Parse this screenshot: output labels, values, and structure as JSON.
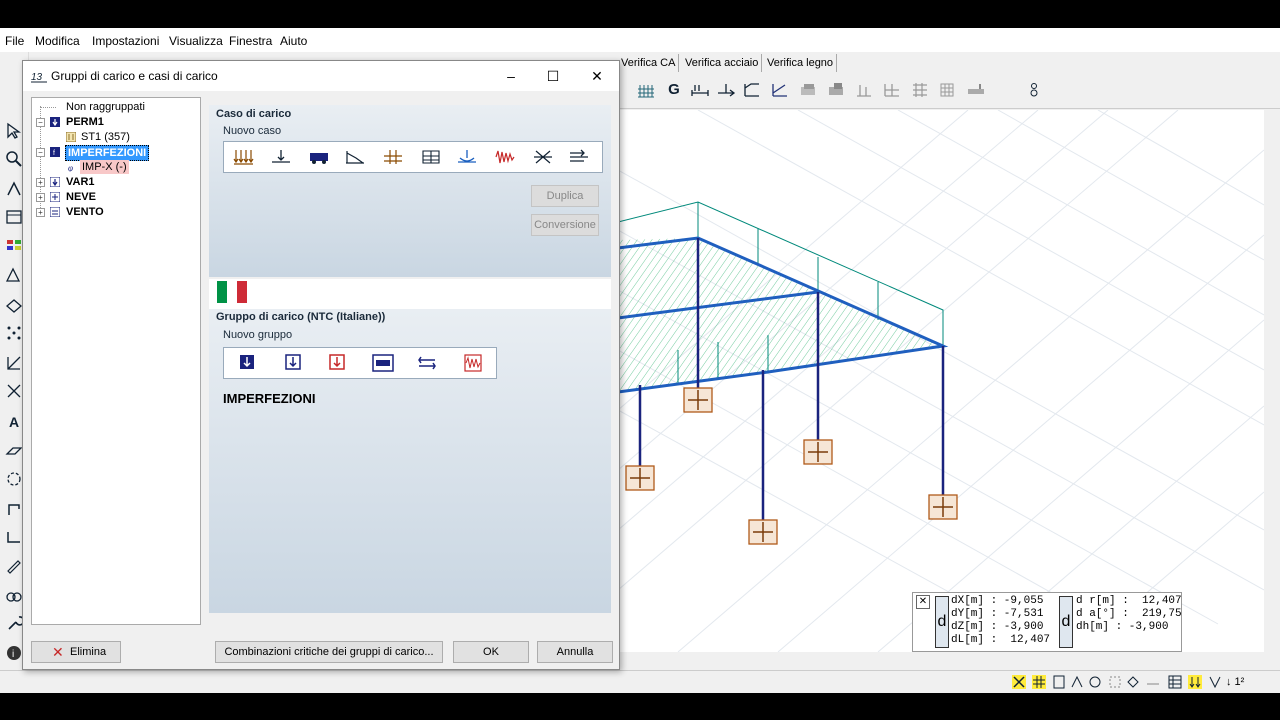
{
  "menubar": {
    "file": "File",
    "modifica": "Modifica",
    "impostazioni": "Impostazioni",
    "visualizza": "Visualizza",
    "finestra": "Finestra",
    "aiuto": "Aiuto"
  },
  "tabs": [
    "Verifica CA",
    "Verifica acciaio",
    "Verifica legno"
  ],
  "ribbon_icons": [
    "grid-icon",
    "g-letter-icon",
    "dimension-icon",
    "arrows-icon",
    "lat-icon",
    "lat2-icon",
    "frame-icon",
    "frame2-icon",
    "axis-icon",
    "plane-icon",
    "mesh-icon",
    "grid2-icon",
    "beam-icon",
    "sequence-icon"
  ],
  "dialog": {
    "title": "Gruppi di carico e casi di carico",
    "minimize": "–",
    "maximize": "☐",
    "close": "✕",
    "tree": {
      "non_raggruppati": "Non raggruppati",
      "perm1": "PERM1",
      "st1": "ST1 (357)",
      "imperfezioni": "IMPERFEZIONI",
      "imp_x": "IMP-X (-)",
      "var1": "VAR1",
      "neve": "NEVE",
      "vento": "VENTO"
    },
    "caso": {
      "title": "Caso di carico",
      "subtitle": "Nuovo caso",
      "icons": [
        "distributed-load-icon",
        "point-load-icon",
        "vehicle-load-icon",
        "trapezoidal-load-icon",
        "linear-load-icon",
        "area-load-icon",
        "moment-load-icon",
        "seismic-load-icon",
        "temperature-load-icon",
        "wind-load-icon"
      ],
      "duplica": "Duplica",
      "conversione": "Conversione"
    },
    "gruppo": {
      "title": "Gruppo di carico (NTC (Italiane))",
      "subtitle": "Nuovo gruppo",
      "icons": [
        "permanent-group-icon",
        "variable-group-icon",
        "accidental-group-icon",
        "traffic-group-icon",
        "wind-group-icon",
        "seismic-group-icon"
      ],
      "selected": "IMPERFEZIONI"
    },
    "buttons": {
      "elimina": "Elimina",
      "combinazioni": "Combinazioni critiche dei gruppi di carico...",
      "ok": "OK",
      "annulla": "Annulla"
    }
  },
  "measure": {
    "dx": "dX[m] : -9,055",
    "dy": "dY[m] : -7,531",
    "dz": "dZ[m] : -3,900",
    "dl": "dL[m] :  12,407",
    "dr": "d r[m] :  12,407",
    "da": "d a[°] :  219,75",
    "dh": "dh[m] : -3,900",
    "d_symbol": "d"
  },
  "colors": {
    "accent": "#3399ff",
    "selection": "#3399ff",
    "beam": "#1a237e",
    "frame": "#00897b",
    "support": "#b05a1a",
    "flag_green": "#009246",
    "flag_red": "#ce2b37"
  }
}
